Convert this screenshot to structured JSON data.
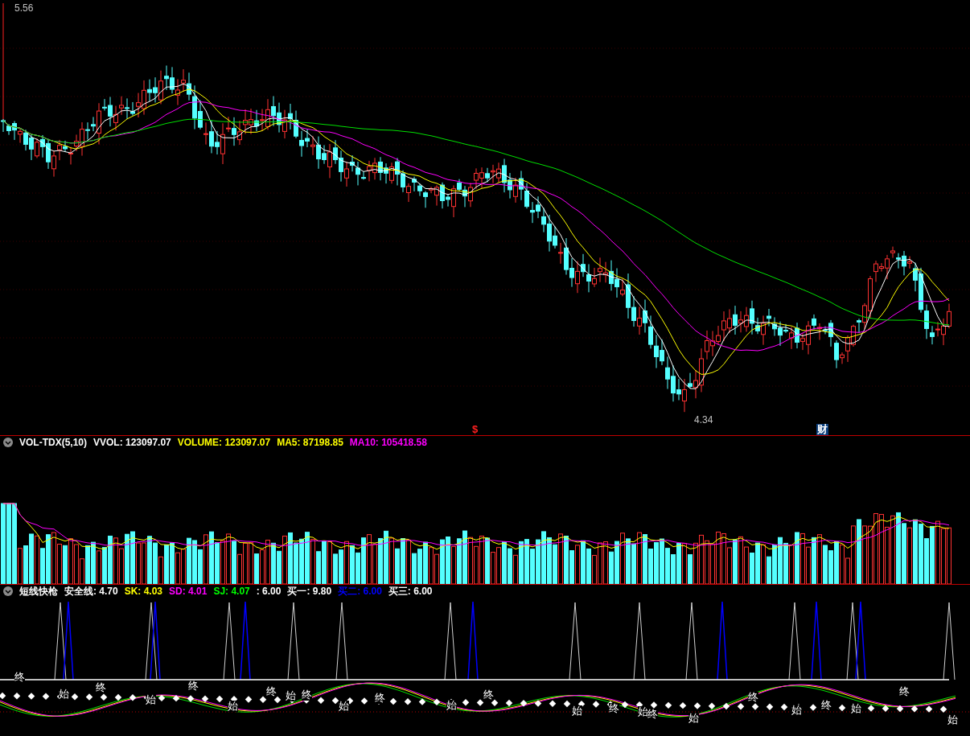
{
  "price_chart": {
    "high_label": "5.56",
    "low_label": "4.34",
    "markers": [
      {
        "text": "$",
        "kind": "plain"
      },
      {
        "text": "财",
        "kind": "boxed"
      }
    ]
  },
  "volume_panel": {
    "header": [
      {
        "text": "VOL-TDX(5,10)",
        "color": "#ffffff"
      },
      {
        "text": "VVOL: 123097.07",
        "color": "#ffffff"
      },
      {
        "text": "VOLUME: 123097.07",
        "color": "#ffff00"
      },
      {
        "text": "MA5: 87198.85",
        "color": "#ffff00"
      },
      {
        "text": "MA10: 105418.58",
        "color": "#ff00ff"
      }
    ]
  },
  "indicator_panel": {
    "header": [
      {
        "text": "短线快枪",
        "color": "#ffffff"
      },
      {
        "text": "安全线: 4.70",
        "color": "#ffffff"
      },
      {
        "text": "SK: 4.03",
        "color": "#ffff00"
      },
      {
        "text": "SD: 4.01",
        "color": "#ff00ff"
      },
      {
        "text": "SJ: 4.07",
        "color": "#00ff00"
      },
      {
        "text": ": 6.00",
        "color": "#ffffff"
      },
      {
        "text": "买一: 9.80",
        "color": "#ffffff"
      },
      {
        "text": "买二: 6.00",
        "color": "#0000ff"
      },
      {
        "text": "买三: 6.00",
        "color": "#ffffff"
      }
    ],
    "signals": [
      "终",
      "始",
      "终",
      "始",
      "终",
      "始",
      "终",
      "始",
      "终",
      "始",
      "终",
      "始",
      "终",
      "始",
      "终",
      "始",
      "终",
      "始",
      "终",
      "始",
      "终",
      "始",
      "终",
      "始"
    ]
  }
}
